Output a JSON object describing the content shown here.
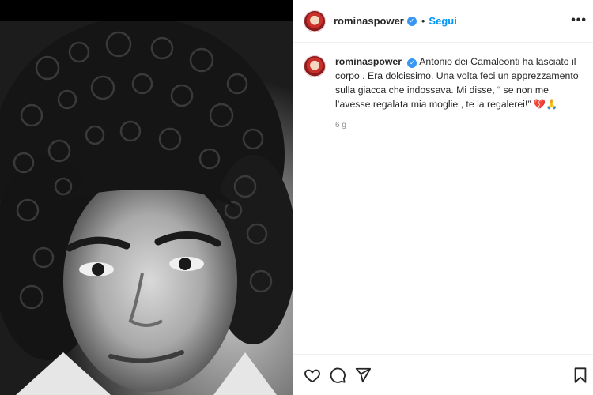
{
  "post": {
    "username": "rominaspower",
    "verified_icon": "verified-badge-icon",
    "separator": "•",
    "follow_label": "Segui",
    "more_label": "•••",
    "caption": {
      "username": "rominaspower",
      "text": "Antonio dei Camaleonti ha lasciato il corpo . Era dolcissimo. Una volta feci un apprezzamento sulla giacca che indossava. Mi disse, “ se non me l’avesse regalata mia moglie , te la regalerei!” ",
      "emojis": "💔🙏"
    },
    "time_ago": "6 g",
    "photo_icon": "portrait-photo",
    "colors": {
      "accent": "#0095f6",
      "verified": "#3897f0",
      "text": "#262626",
      "muted": "#8e8e8e"
    }
  },
  "actions": {
    "like_icon": "heart-icon",
    "comment_icon": "comment-icon",
    "share_icon": "paper-plane-icon",
    "save_icon": "bookmark-icon"
  }
}
